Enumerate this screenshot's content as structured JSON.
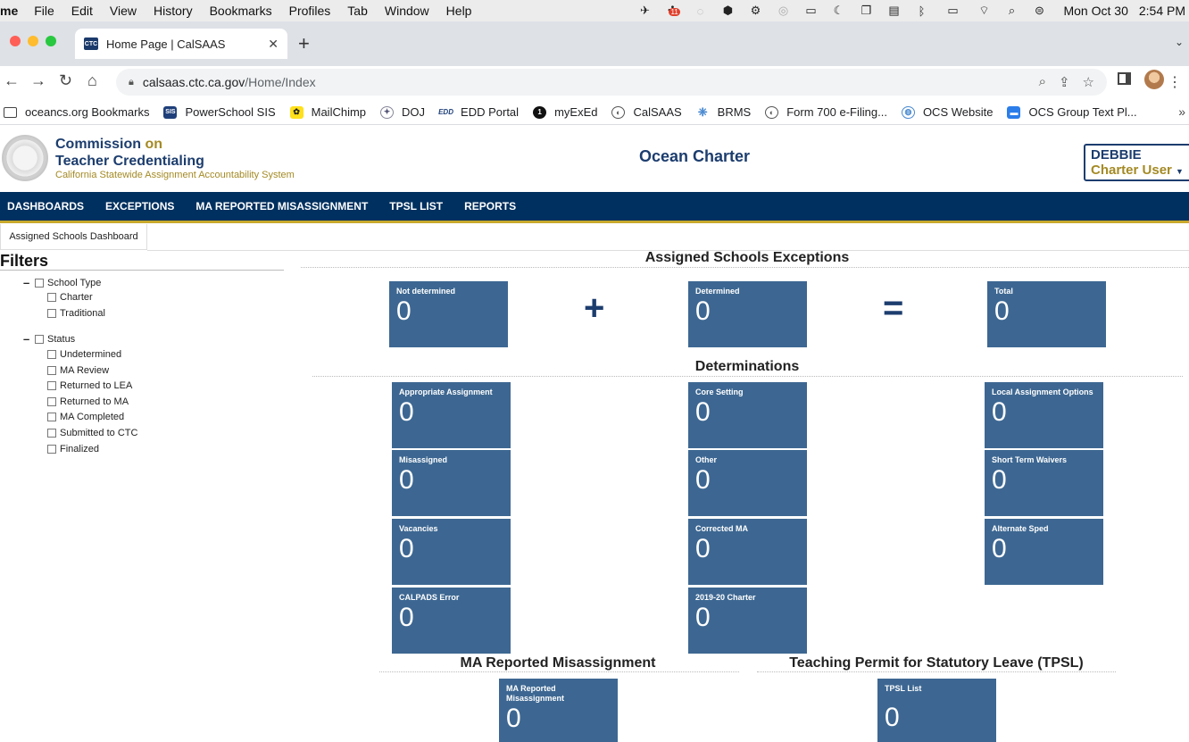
{
  "menubar": {
    "app": "me",
    "items": [
      "File",
      "Edit",
      "View",
      "History",
      "Bookmarks",
      "Profiles",
      "Tab",
      "Window",
      "Help"
    ],
    "badge": "11",
    "date": "Mon Oct 30",
    "time": "2:54 PM"
  },
  "browser": {
    "tab_title": "Home Page | CalSAAS",
    "tab_favicon": "CTC",
    "url_host": "calsaas.ctc.ca.gov",
    "url_path": "/Home/Index"
  },
  "bookmarks": [
    {
      "label": "oceancs.org Bookmarks",
      "icon": "folder-icon"
    },
    {
      "label": "PowerSchool SIS",
      "icon": "powerschool-icon"
    },
    {
      "label": "MailChimp",
      "icon": "mailchimp-icon"
    },
    {
      "label": "DOJ",
      "icon": "doj-icon"
    },
    {
      "label": "EDD Portal",
      "icon": "edd-icon"
    },
    {
      "label": "myExEd",
      "icon": "myexed-icon"
    },
    {
      "label": "CalSAAS",
      "icon": "globe-icon"
    },
    {
      "label": "BRMS",
      "icon": "brms-icon"
    },
    {
      "label": "Form 700 e-Filing...",
      "icon": "globe-icon"
    },
    {
      "label": "OCS Website",
      "icon": "ocs-icon"
    },
    {
      "label": "OCS Group Text Pl...",
      "icon": "chat-icon"
    }
  ],
  "site": {
    "org_line1": "Commission",
    "org_on": "on",
    "org_line2": "Teacher Credentialing",
    "org_sub": "California Statewide Assignment Accountability System",
    "title": "Ocean Charter",
    "user_name": "DEBBIE",
    "user_role": "Charter User"
  },
  "nav": [
    "DASHBOARDS",
    "EXCEPTIONS",
    "MA REPORTED MISASSIGNMENT",
    "TPSL LIST",
    "REPORTS"
  ],
  "subtab": "Assigned Schools Dashboard",
  "filters": {
    "title": "Filters",
    "school_type": "School Type",
    "school_type_options": [
      "Charter",
      "Traditional"
    ],
    "status": "Status",
    "status_options": [
      "Undetermined",
      "MA Review",
      "Returned to LEA",
      "Returned to MA",
      "MA Completed",
      "Submitted to CTC",
      "Finalized"
    ]
  },
  "exceptions": {
    "title": "Assigned Schools Exceptions",
    "not_determined": {
      "label": "Not determined",
      "value": "0"
    },
    "plus": "+",
    "determined": {
      "label": "Determined",
      "value": "0"
    },
    "equals": "=",
    "total": {
      "label": "Total",
      "value": "0"
    }
  },
  "determinations": {
    "title": "Determinations",
    "col1": [
      {
        "label": "Appropriate Assignment",
        "value": "0"
      },
      {
        "label": "Misassigned",
        "value": "0"
      },
      {
        "label": "Vacancies",
        "value": "0"
      },
      {
        "label": "CALPADS Error",
        "value": "0"
      }
    ],
    "col2": [
      {
        "label": "Core Setting",
        "value": "0"
      },
      {
        "label": "Other",
        "value": "0"
      },
      {
        "label": "Corrected MA",
        "value": "0"
      },
      {
        "label": "2019-20 Charter",
        "value": "0"
      }
    ],
    "col3": [
      {
        "label": "Local Assignment Options",
        "value": "0"
      },
      {
        "label": "Short Term Waivers",
        "value": "0"
      },
      {
        "label": "Alternate Sped",
        "value": "0"
      }
    ]
  },
  "ma_reported": {
    "title": "MA Reported Misassignment",
    "tile_label": "MA Reported Misassignment",
    "value": "0"
  },
  "tpsl": {
    "title": "Teaching Permit for Statutory Leave (TPSL)",
    "tile_label": "TPSL List",
    "value": "0"
  }
}
